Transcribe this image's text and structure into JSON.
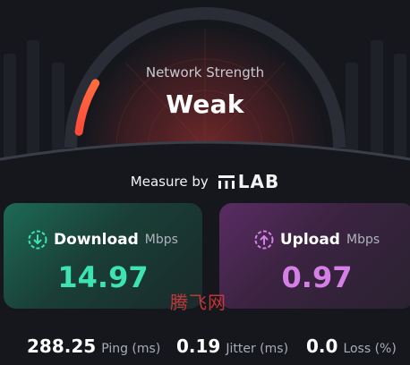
{
  "gauge": {
    "label": "Network Strength",
    "value": "Weak",
    "level_fraction": 0.12
  },
  "measure": {
    "text": "Measure by",
    "logo_text": "LAB"
  },
  "download": {
    "title": "Download",
    "unit": "Mbps",
    "value": "14.97",
    "icon": "download-circle-icon",
    "color": "#3de3b0"
  },
  "upload": {
    "title": "Upload",
    "unit": "Mbps",
    "value": "0.97",
    "icon": "upload-circle-icon",
    "color": "#d67fe6"
  },
  "stats": {
    "ping": {
      "value": "288.25",
      "label": "Ping (ms)"
    },
    "jitter": {
      "value": "0.19",
      "label": "Jitter (ms)"
    },
    "loss": {
      "value": "0.0",
      "label": "Loss (%)"
    }
  },
  "watermark": "腾飞网",
  "colors": {
    "background": "#15171c",
    "gauge_arc": "#ff4f3a",
    "download_accent": "#3de3b0",
    "upload_accent": "#d67fe6"
  }
}
